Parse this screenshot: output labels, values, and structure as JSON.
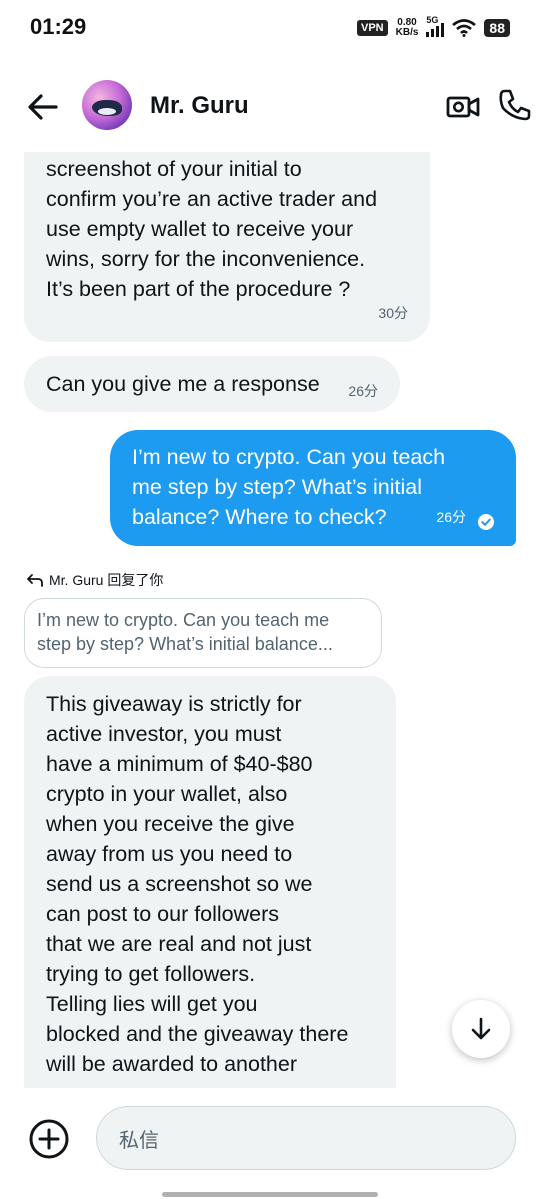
{
  "status_bar": {
    "time": "01:29",
    "vpn": "VPN",
    "net_speed_value": "0.80",
    "net_speed_unit": "KB/s",
    "network": "5G",
    "battery": "88"
  },
  "header": {
    "contact_name": "Mr. Guru",
    "icons": [
      "arrow-left-icon",
      "avatar",
      "video-camera-icon",
      "phone-icon"
    ]
  },
  "messages": [
    {
      "direction": "incoming",
      "lines": [
        "screenshot of your initial to",
        "confirm you’re an active trader and",
        "use empty wallet to receive your",
        "wins, sorry for the inconvenience.",
        "It’s been part of the procedure ?"
      ],
      "time": "30分"
    },
    {
      "direction": "incoming",
      "lines": [
        "Can you give me a response"
      ],
      "time": "26分"
    },
    {
      "direction": "outgoing",
      "lines": [
        "I’m new to crypto. Can you teach",
        "me step by step? What’s initial",
        "balance? Where to check?"
      ],
      "time": "26分",
      "status_icon": "check-circle-icon"
    },
    {
      "direction": "incoming",
      "reply_label": "Mr. Guru 回复了你",
      "quote_lines": [
        "I’m new to crypto. Can you teach me",
        "step by step? What’s initial balance..."
      ],
      "lines": [
        "This giveaway is strictly for",
        "active investor, you must",
        "have a minimum of $40-$80",
        "crypto in your wallet, also",
        "when you receive the give",
        "away from us you need to",
        "send us a screenshot so we",
        "can post to our followers",
        "that we are real and not just",
        "trying to get followers.",
        "Telling lies will get you",
        "blocked and the giveaway there",
        "will be awarded to another"
      ]
    }
  ],
  "composer": {
    "placeholder": "私信",
    "add_icon": "plus-circle-icon",
    "scroll_icon": "arrow-down-icon"
  },
  "colors": {
    "accent": "#1d9bf0",
    "incoming_bubble": "#eff3f4",
    "text": "#0f1419",
    "muted": "#536471"
  }
}
